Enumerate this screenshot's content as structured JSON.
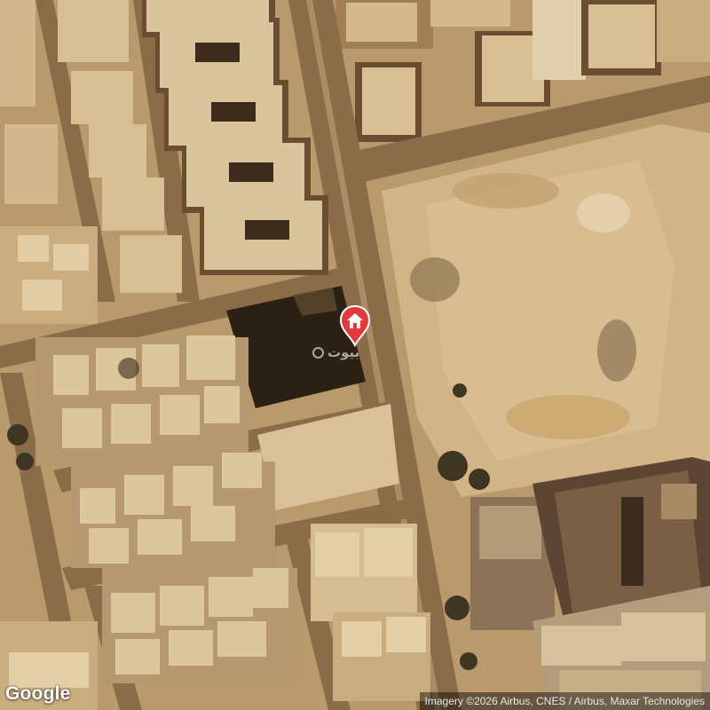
{
  "map": {
    "type": "satellite",
    "colors": {
      "ground": "#b99a6c",
      "road": "#8a6c48",
      "roof": "#d7bf93",
      "roof_shadow": "#6e5234",
      "dark_lot": "#2b2014",
      "empty_lot": "#d4b98a",
      "marker": "#e23a3a"
    }
  },
  "marker": {
    "icon": "home-pin-icon",
    "brand_text": "بيوت"
  },
  "logo": {
    "text": "Google"
  },
  "attribution": {
    "text": "Imagery ©2026 Airbus, CNES / Airbus, Maxar Technologies"
  }
}
